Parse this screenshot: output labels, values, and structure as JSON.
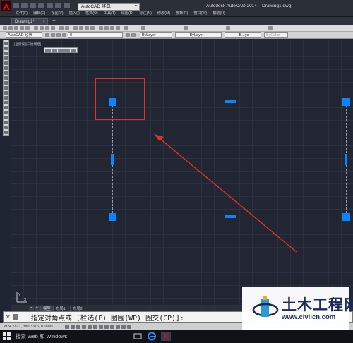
{
  "window": {
    "app_title": "Autodesk AutoCAD 2014    Drawing1.dwg",
    "workspace": "AutoCAD 经典",
    "menus": [
      "文件(F)",
      "编辑(E)",
      "视图(V)",
      "插入(I)",
      "格式(O)",
      "工具(T)",
      "绘图(D)",
      "标注(N)",
      "修改(M)",
      "参数(P)",
      "窗口(W)",
      "帮助(H)"
    ]
  },
  "file_tab": {
    "label": "Drawing1*",
    "close": "×",
    "new": "+"
  },
  "toolbar": {
    "workspace_field": "AutoCAD 经典",
    "layer_field": "0",
    "color_field": "ByLayer",
    "linetype_field": "——— ByLayer",
    "lineweight_field": "——— B...ye",
    "plotstyle_field": "ByColor"
  },
  "viewport": {
    "label": "[-][俯视][二维线框]"
  },
  "layout_tabs": [
    "模型",
    "布局1",
    "布局2"
  ],
  "command_line": {
    "close": "✕",
    "text": "  指定对角点或 [栏选(F) 圈围(WP) 圈交(CP)]:"
  },
  "status": {
    "coords": "3924.7821, 380.3315, 0.0000"
  },
  "taskbar": {
    "search": "搜索 Web 和 Windows"
  },
  "watermark": {
    "title": "土木工程网",
    "url": "www.civilcn.com"
  },
  "colors": {
    "grip": "#0a84ff",
    "annotation": "#e03131",
    "canvas": "#212632",
    "app_icon": "#c8102e"
  },
  "icons": {
    "app": "autocad-a-icon",
    "start": "windows-logo-icon",
    "ucs": "ucs-axes-icon",
    "watermark_logo": "civilcn-logo"
  }
}
